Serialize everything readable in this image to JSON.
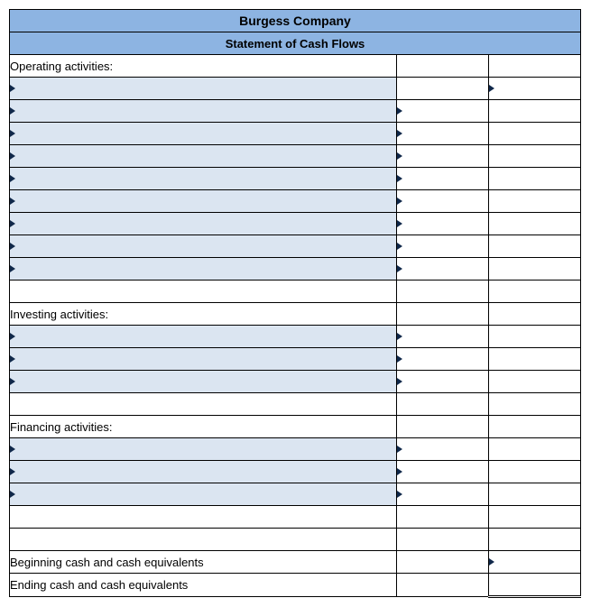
{
  "header": {
    "company": "Burgess Company",
    "statement": "Statement of Cash Flows"
  },
  "sections": {
    "operating_label": "Operating activities:",
    "investing_label": "Investing activities:",
    "financing_label": "Financing activities:",
    "beginning_cash_label": "Beginning cash and cash equivalents",
    "ending_cash_label": "Ending cash and cash equivalents"
  },
  "rows": {
    "op": [
      {
        "desc": "",
        "a": "",
        "b": ""
      },
      {
        "desc": "",
        "a": "",
        "b": ""
      },
      {
        "desc": "",
        "a": "",
        "b": ""
      },
      {
        "desc": "",
        "a": "",
        "b": ""
      },
      {
        "desc": "",
        "a": "",
        "b": ""
      },
      {
        "desc": "",
        "a": "",
        "b": ""
      },
      {
        "desc": "",
        "a": "",
        "b": ""
      },
      {
        "desc": "",
        "a": "",
        "b": ""
      },
      {
        "desc": "",
        "a": "",
        "b": ""
      }
    ],
    "op_total": {
      "a": "",
      "b": ""
    },
    "inv": [
      {
        "desc": "",
        "a": "",
        "b": ""
      },
      {
        "desc": "",
        "a": "",
        "b": ""
      },
      {
        "desc": "",
        "a": "",
        "b": ""
      }
    ],
    "inv_total": {
      "a": "",
      "b": ""
    },
    "fin": [
      {
        "desc": "",
        "a": "",
        "b": ""
      },
      {
        "desc": "",
        "a": "",
        "b": ""
      },
      {
        "desc": "",
        "a": "",
        "b": ""
      }
    ],
    "fin_total": {
      "a": "",
      "b": ""
    },
    "change_total": {
      "a": "",
      "b": ""
    },
    "beginning": {
      "a": "",
      "b": ""
    },
    "ending": {
      "a": "",
      "b": ""
    }
  }
}
